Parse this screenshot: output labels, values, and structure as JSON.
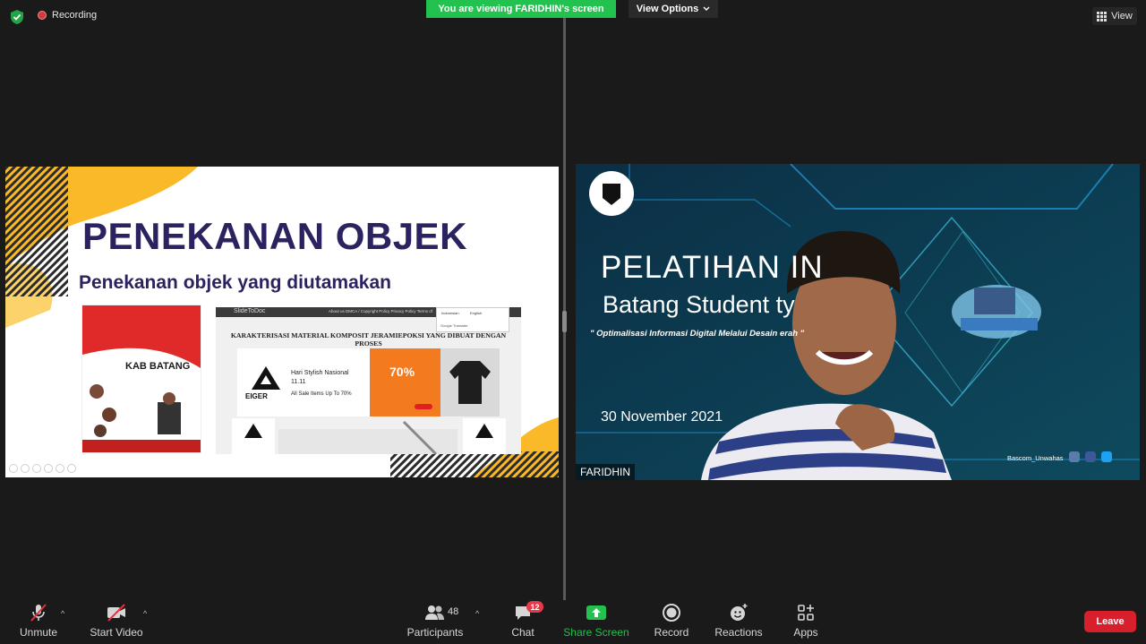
{
  "meeting": {
    "recording_label": "Recording",
    "viewing_banner": "You are viewing FARIDHIN's screen",
    "view_options_label": "View Options",
    "view_button_label": "View"
  },
  "slide": {
    "title": "PENEKANAN OBJEK",
    "subtitle": "Penekanan objek yang diutamakan",
    "poster_text": "KAB BATANG",
    "webpage": {
      "logo": "SlideToDoc",
      "links": "About us   DMCA / Copyright Policy   Privacy Policy   Terms of",
      "popup_lang_a": "Indonesian",
      "popup_lang_b": "English",
      "popup_translate": "Google Translate",
      "heading": "KARAKTERISASI MATERIAL KOMPOSIT JERAMIEPOKSI YANG DIBUAT DENGAN PROSES",
      "ad_brand": "EIGER",
      "ad_line1": "Hari Stylish Nasional",
      "ad_line2": "11.11",
      "ad_line3": "All Sale Items Up To 70%",
      "ad_percent": "70%"
    }
  },
  "video": {
    "title": "PELATIHAN      IN",
    "subtitle": "Batang Student            ty",
    "optimization": "\" Optimalisasi Informasi Digital Melalui Desain                          erah \"",
    "date": "30 November 2021",
    "handle": "Bascom_Unwahas",
    "participant_name": "FARIDHIN"
  },
  "toolbar": {
    "unmute": "Unmute",
    "start_video": "Start Video",
    "participants": "Participants",
    "participants_count": "48",
    "chat": "Chat",
    "chat_badge": "12",
    "share_screen": "Share Screen",
    "record": "Record",
    "reactions": "Reactions",
    "apps": "Apps",
    "leave": "Leave"
  },
  "colors": {
    "accent_green": "#23c14f",
    "leave_red": "#d7202c",
    "slide_navy": "#2a2360",
    "slide_yellow": "#f9b928"
  }
}
